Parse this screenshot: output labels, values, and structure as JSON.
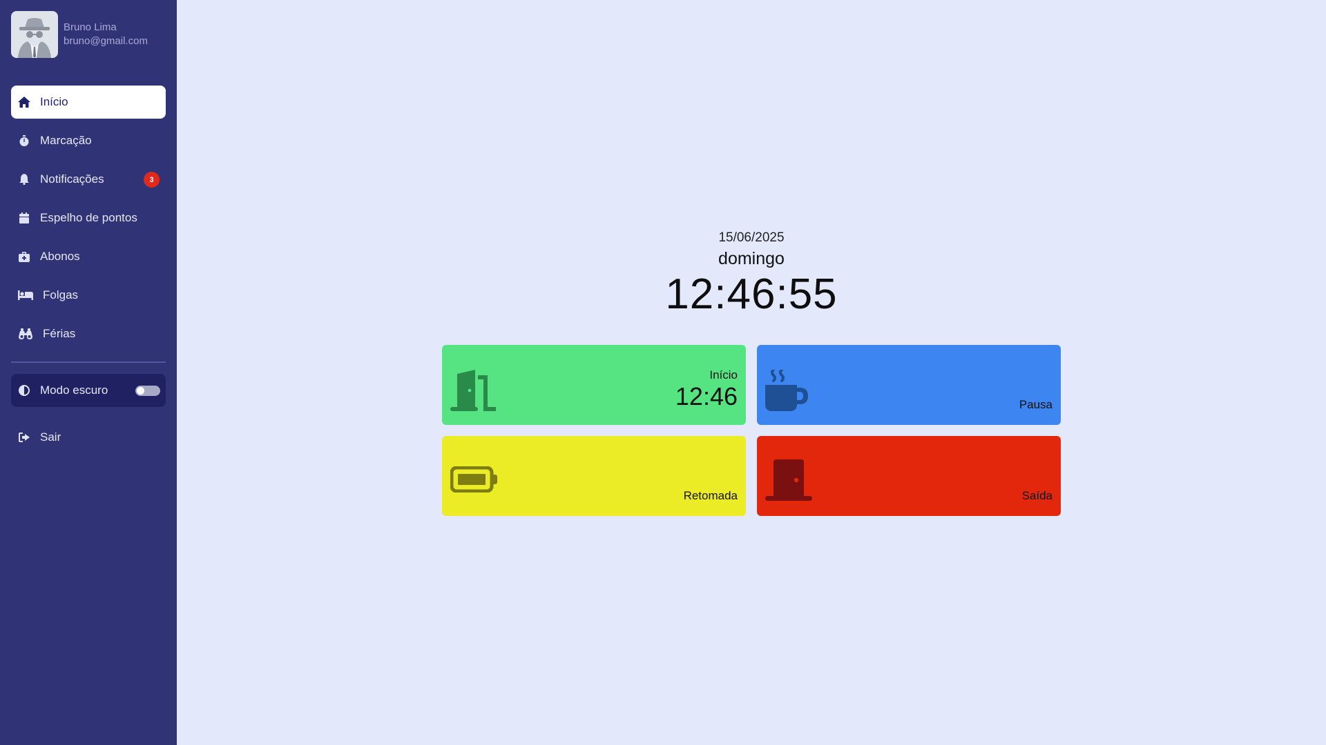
{
  "profile": {
    "name": "Bruno Lima",
    "email": "bruno@gmail.com"
  },
  "nav": {
    "items": [
      {
        "label": "Início",
        "icon": "home-icon",
        "active": true
      },
      {
        "label": "Marcação",
        "icon": "stopwatch-icon"
      },
      {
        "label": "Notificações",
        "icon": "bell-icon",
        "badge": "3"
      },
      {
        "label": "Espelho de pontos",
        "icon": "calendar-icon"
      },
      {
        "label": "Abonos",
        "icon": "medical-bag-icon"
      },
      {
        "label": "Folgas",
        "icon": "bed-icon"
      },
      {
        "label": "Férias",
        "icon": "binoculars-icon"
      }
    ]
  },
  "dark_mode": {
    "label": "Modo escuro",
    "enabled": false
  },
  "logout": {
    "label": "Sair"
  },
  "clock": {
    "date": "15/06/2025",
    "weekday": "domingo",
    "time": "12:46:55"
  },
  "cards": [
    {
      "label": "Início",
      "time": "12:46",
      "color": "#56e382",
      "icon": "door-open-icon"
    },
    {
      "label": "Pausa",
      "color": "#3d86f2",
      "icon": "coffee-mug-icon"
    },
    {
      "label": "Retomada",
      "color": "#ebeb26",
      "icon": "battery-icon"
    },
    {
      "label": "Saída",
      "color": "#e2270c",
      "icon": "door-closed-icon"
    }
  ],
  "colors": {
    "sidebar": "#313377",
    "background": "#e3e8fb",
    "badge": "#e0281b"
  }
}
